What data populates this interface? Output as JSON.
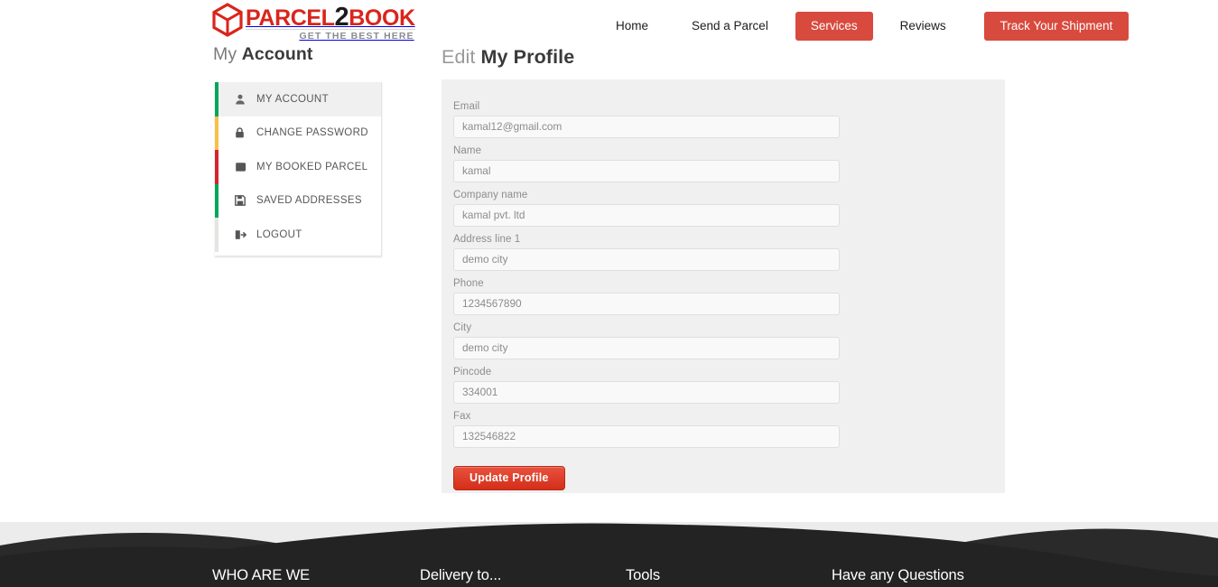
{
  "brand": {
    "logo_icon": "cube-icon",
    "name_part1": "PARCEL",
    "name_part2": "2",
    "name_part3": "BOOK",
    "tagline": "GET THE BEST HERE",
    "primary_color": "#d84a3e",
    "logo_red": "#d9251c"
  },
  "nav": {
    "items": [
      {
        "label": "Home",
        "type": "link",
        "active": false
      },
      {
        "label": "Send a Parcel",
        "type": "link",
        "active": false
      },
      {
        "label": "Services",
        "type": "button",
        "active": true
      },
      {
        "label": "Reviews",
        "type": "link",
        "active": false
      },
      {
        "label": "Track Your Shipment",
        "type": "button",
        "active": false
      }
    ]
  },
  "sidebar": {
    "title_light": "My",
    "title_strong": "Account",
    "items": [
      {
        "label": "MY ACCOUNT",
        "icon": "user-icon",
        "accent": "#00a65a",
        "active": true
      },
      {
        "label": "CHANGE PASSWORD",
        "icon": "lock-icon",
        "accent": "#f7c04a",
        "active": false
      },
      {
        "label": "MY BOOKED PARCEL",
        "icon": "book-icon",
        "accent": "#d6242c",
        "active": false
      },
      {
        "label": "SAVED ADDRESSES",
        "icon": "floppy-disk-icon",
        "accent": "#00a65a",
        "active": false
      },
      {
        "label": "LOGOUT",
        "icon": "sign-out-icon",
        "accent": "#e3e6e1",
        "active": false
      }
    ]
  },
  "main": {
    "title_light": "Edit",
    "title_strong": "My Profile",
    "fields": [
      {
        "label": "Email",
        "value": "kamal12@gmail.com",
        "name": "email-field"
      },
      {
        "label": "Name",
        "value": "kamal",
        "name": "name-field"
      },
      {
        "label": "Company name",
        "value": "kamal pvt. ltd",
        "name": "company-name-field"
      },
      {
        "label": "Address line 1",
        "value": "demo city",
        "name": "address-line-1-field"
      },
      {
        "label": "Phone",
        "value": "1234567890",
        "name": "phone-field"
      },
      {
        "label": "City",
        "value": "demo city",
        "name": "city-field"
      },
      {
        "label": "Pincode",
        "value": "334001",
        "name": "pincode-field"
      },
      {
        "label": "Fax",
        "value": "132546822",
        "name": "fax-field"
      }
    ],
    "submit_label": "Update Profile"
  },
  "footer": {
    "columns": [
      {
        "heading": "WHO ARE WE"
      },
      {
        "heading": "Delivery to..."
      },
      {
        "heading": "Tools"
      },
      {
        "heading": "Have any Questions"
      }
    ]
  }
}
